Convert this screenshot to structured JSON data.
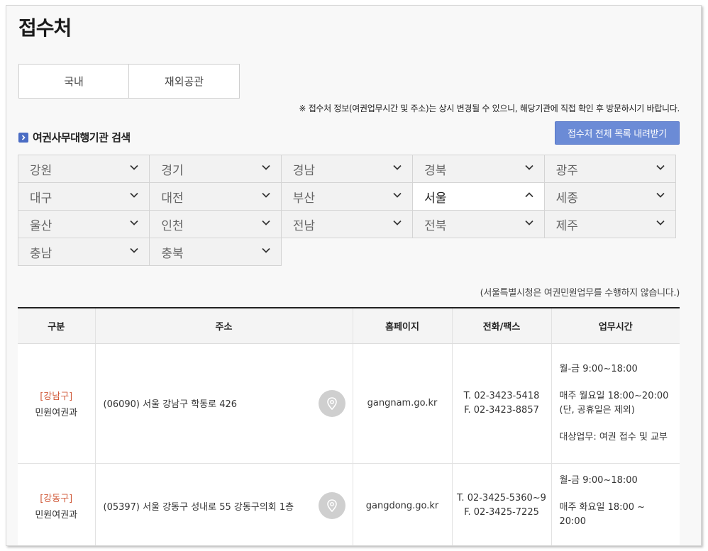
{
  "page": {
    "title": "접수처"
  },
  "tabs": [
    "국내",
    "재외공관"
  ],
  "notice": "※ 접수처 정보(여권업무시간 및 주소)는 상시 변경될 수 있으니, 해당기관에 직접 확인 후 방문하시기 바랍니다.",
  "section": {
    "title": "여권사무대행기관 검색",
    "download_label": "접수처 전체 목록 내려받기"
  },
  "regions": [
    [
      "강원",
      "경기",
      "경남",
      "경북",
      "광주"
    ],
    [
      "대구",
      "대전",
      "부산",
      "서울",
      "세종"
    ],
    [
      "울산",
      "인천",
      "전남",
      "전북",
      "제주"
    ],
    [
      "충남",
      "충북"
    ]
  ],
  "selected_region": "서울",
  "sub_notice": "(서울특별시청은 여권민원업무를 수행하지 않습니다.)",
  "table": {
    "headers": [
      "구분",
      "주소",
      "홈페이지",
      "전화/팩스",
      "업무시간"
    ],
    "rows": [
      {
        "gu": "[강남구]",
        "dept": "민원여권과",
        "address": "(06090) 서울 강남구 학동로 426",
        "homepage": "gangnam.go.kr",
        "tel": "T. 02-3423-5418",
        "fax": "F. 02-3423-8857",
        "hours": [
          "월-금 9:00~18:00",
          "매주 월요일 18:00~20:00\n(단, 공휴일은 제외)",
          "대상업무: 여권 접수 및 교부"
        ]
      },
      {
        "gu": "[강동구]",
        "dept": "민원여권과",
        "address": "(05397) 서울 강동구 성내로 55 강동구의회 1층",
        "homepage": "gangdong.go.kr",
        "tel": "T. 02-3425-5360~9",
        "fax": "F. 02-3425-7225",
        "hours": [
          "월-금 9:00~18:00",
          "매주 화요일 18:00 ~ 20:00"
        ]
      }
    ]
  },
  "colors": {
    "accent": "#6b8bd6",
    "district": "#d05a3a",
    "section_icon": "#4a6cc4"
  },
  "icons": {
    "section": "chevron-right-icon",
    "dropdown": "chevron-down-icon",
    "dropdown_open": "chevron-up-icon",
    "map": "map-pin-icon"
  }
}
